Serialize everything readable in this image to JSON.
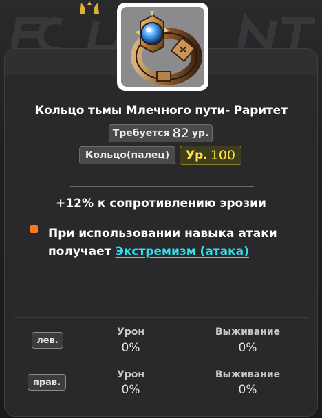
{
  "item": {
    "icon": "ring-icon",
    "name": "Кольцо тьмы Млечного пути- Раритет",
    "requirement_label": "Требуется",
    "requirement_level": "82",
    "requirement_unit": "ур.",
    "slot": "Кольцо(палец)",
    "level_prefix": "Ур.",
    "level_value": "100"
  },
  "stats": {
    "bonus": "+12% к сопротивлению эрозии",
    "effect_text": "При использовании навыка атаки получает ",
    "effect_link": "Экстремизм (атака)",
    "bullet_color": "#ff7a1e"
  },
  "hands": {
    "left_label": "лев.",
    "right_label": "прав.",
    "damage_label": "Урон",
    "survival_label": "Выживание",
    "left_damage": "0%",
    "left_survival": "0%",
    "right_damage": "0%",
    "right_survival": "0%"
  },
  "colors": {
    "link": "#2fe0f0",
    "level": "#ffe34d"
  }
}
